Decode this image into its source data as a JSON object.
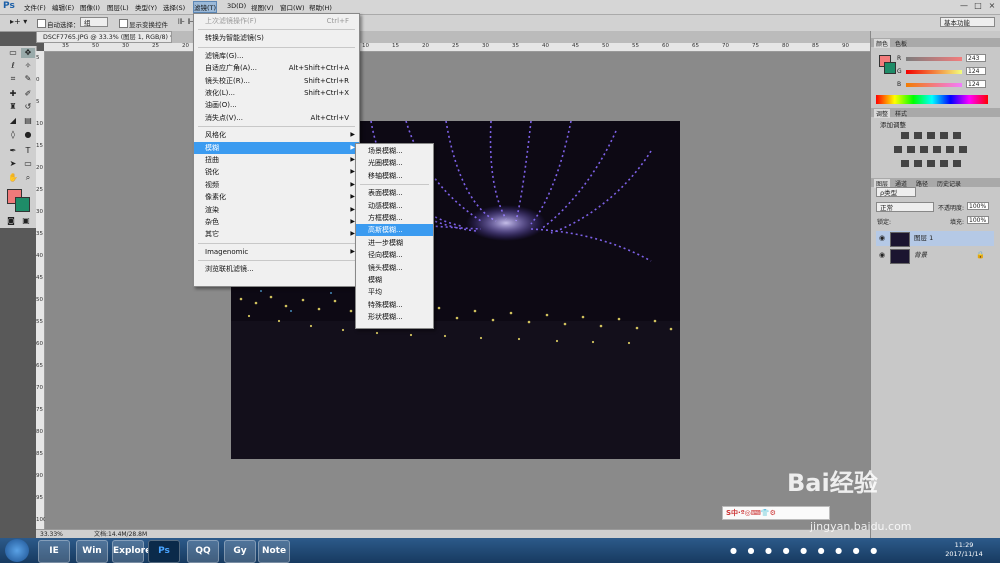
{
  "app": {
    "logo": "Ps"
  },
  "menubar": {
    "items": [
      "文件(F)",
      "编辑(E)",
      "图像(I)",
      "图层(L)",
      "类型(Y)",
      "选择(S)",
      "滤镜(T)",
      "3D(D)",
      "视图(V)",
      "窗口(W)",
      "帮助(H)"
    ],
    "active": "滤镜(T)",
    "window_buttons": [
      "—",
      "□",
      "×"
    ]
  },
  "options": {
    "auto_select_label": "自动选择：",
    "auto_select_value": "组",
    "show_transform_label": "显示变换控件",
    "workspace": "基本功能"
  },
  "document": {
    "tab_title": "DSCF7765.JPG @ 33.3% (图层 1, RGB/8) *",
    "zoom": "33.33%",
    "doc_size": "文档:14.4M/28.8M"
  },
  "ruler": {
    "top_ticks": [
      "35",
      "50",
      "30",
      "25",
      "20",
      "15",
      "10",
      "5",
      "0",
      "5",
      "10",
      "15",
      "20",
      "25",
      "30",
      "35",
      "40",
      "45",
      "50",
      "55",
      "60",
      "65",
      "70",
      "75",
      "80",
      "85",
      "90"
    ],
    "left_ticks": [
      "5",
      "0",
      "5",
      "10",
      "15",
      "20",
      "25",
      "30",
      "35",
      "40",
      "45",
      "50",
      "55",
      "60",
      "65",
      "70",
      "75",
      "80",
      "85",
      "90",
      "95",
      "100"
    ]
  },
  "filter_menu": {
    "items": [
      {
        "label": "上次滤镜操作(F)",
        "shortcut": "Ctrl+F",
        "disabled": true
      },
      {
        "sep": true
      },
      {
        "label": "转换为智能滤镜(S)"
      },
      {
        "sep": true
      },
      {
        "label": "滤镜库(G)..."
      },
      {
        "label": "自适应广角(A)...",
        "shortcut": "Alt+Shift+Ctrl+A"
      },
      {
        "label": "镜头校正(R)...",
        "shortcut": "Shift+Ctrl+R"
      },
      {
        "label": "液化(L)...",
        "shortcut": "Shift+Ctrl+X"
      },
      {
        "label": "油画(O)..."
      },
      {
        "label": "消失点(V)...",
        "shortcut": "Alt+Ctrl+V"
      },
      {
        "sep": true
      },
      {
        "label": "风格化",
        "submenu": true
      },
      {
        "label": "模糊",
        "submenu": true,
        "highlight": true
      },
      {
        "label": "扭曲",
        "submenu": true
      },
      {
        "label": "锐化",
        "submenu": true
      },
      {
        "label": "视频",
        "submenu": true
      },
      {
        "label": "像素化",
        "submenu": true
      },
      {
        "label": "渲染",
        "submenu": true
      },
      {
        "label": "杂色",
        "submenu": true
      },
      {
        "label": "其它",
        "submenu": true
      },
      {
        "sep": true
      },
      {
        "label": "Imagenomic",
        "submenu": true
      },
      {
        "sep": true
      },
      {
        "label": "浏览联机滤镜..."
      }
    ]
  },
  "blur_submenu": {
    "items": [
      {
        "label": "场景模糊..."
      },
      {
        "label": "光圈模糊..."
      },
      {
        "label": "移轴模糊..."
      },
      {
        "sep": true
      },
      {
        "label": "表面模糊..."
      },
      {
        "label": "动感模糊..."
      },
      {
        "label": "方框模糊..."
      },
      {
        "label": "高斯模糊...",
        "highlight": true
      },
      {
        "label": "进一步模糊"
      },
      {
        "label": "径向模糊..."
      },
      {
        "label": "镜头模糊..."
      },
      {
        "label": "模糊"
      },
      {
        "label": "平均"
      },
      {
        "label": "特殊模糊..."
      },
      {
        "label": "形状模糊..."
      }
    ]
  },
  "color_panel": {
    "tabs": [
      "颜色",
      "色板"
    ],
    "channels": [
      {
        "name": "R",
        "value": "243",
        "color": "#f07a7a"
      },
      {
        "name": "G",
        "value": "124",
        "color": "#7adf7a"
      },
      {
        "name": "B",
        "value": "124",
        "color": "#7a7af0"
      }
    ],
    "foreground": "#f37c7c",
    "background": "#1e8c68"
  },
  "adjust_panel": {
    "tabs": [
      "调整",
      "样式"
    ],
    "title": "添加调整"
  },
  "layers_panel": {
    "tabs": [
      "图层",
      "通道",
      "路径",
      "历史记录"
    ],
    "kind_label": "ρ类型",
    "blend_mode": "正常",
    "opacity_label": "不透明度:",
    "opacity_value": "100%",
    "lock_label": "锁定:",
    "fill_label": "填充:",
    "fill_value": "100%",
    "layers": [
      {
        "name": "图层 1",
        "selected": true
      },
      {
        "name": "背景",
        "locked": true
      }
    ]
  },
  "ime": {
    "label": "S中·º◎⌨👕⚙"
  },
  "watermark": {
    "brand": "Bai经验",
    "url": "jingyan.baidu.com"
  },
  "taskbar": {
    "apps": [
      "IE",
      "Win",
      "Explorer",
      "Ps",
      "QQ",
      "Gy",
      "Note"
    ],
    "time": "11:29",
    "date": "2017/11/14"
  }
}
